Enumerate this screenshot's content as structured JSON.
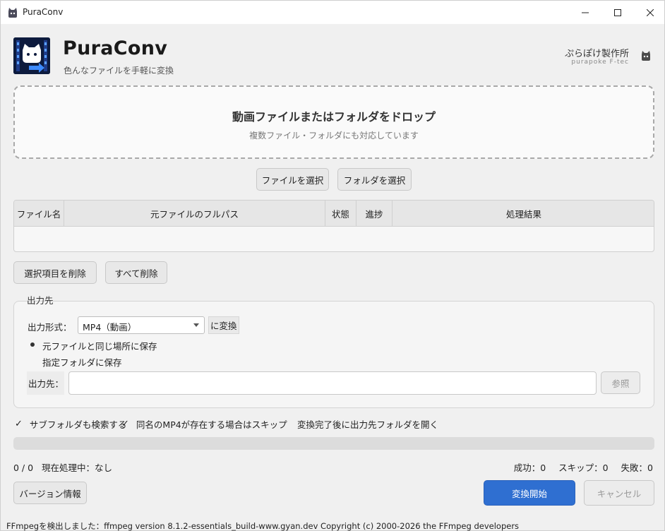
{
  "window": {
    "title": "PuraConv",
    "controls": {
      "minimize": "minimize-icon",
      "maximize": "maximize-icon",
      "close": "close-icon"
    }
  },
  "header": {
    "app_name": "PuraConv",
    "subtitle": "色んなファイルを手軽に変換",
    "maker": "ぷらぽけ製作所",
    "maker_sub": "purapoke F-tec"
  },
  "dropzone": {
    "title": "動画ファイルまたはフォルダをドロップ",
    "subtitle": "複数ファイル・フォルダにも対応しています"
  },
  "select_buttons": {
    "file": "ファイルを選択",
    "folder": "フォルダを選択"
  },
  "table": {
    "columns": [
      "ファイル名",
      "元ファイルのフルパス",
      "状態",
      "進捗",
      "処理結果"
    ],
    "rows": []
  },
  "list_actions": {
    "delete_selected": "選択項目を削除",
    "delete_all": "すべて削除"
  },
  "output": {
    "group_label": "出力先",
    "format_label": "出力形式：",
    "format_value": "MP4（動画）",
    "format_suffix": "に変換",
    "radio_same": "元ファイルと同じ場所に保存",
    "radio_folder": "指定フォルダに保存",
    "radio_selected": "same",
    "dest_label": "出力先：",
    "dest_value": "",
    "browse": "参照"
  },
  "options": {
    "subfolders": {
      "label": "サブフォルダも検索する",
      "checked": true
    },
    "skip_existing": {
      "label": "同名のMP4が存在する場合はスキップ",
      "checked": true
    },
    "open_after": {
      "label": "変換完了後に出力先フォルダを開く",
      "checked": false
    }
  },
  "progress": {
    "value": 0
  },
  "status": {
    "count": "0 / 0",
    "current": "現在処理中：なし",
    "success": "成功：0",
    "skip": "スキップ：0",
    "failed": "失敗：0"
  },
  "actions": {
    "version": "バージョン情報",
    "start": "変換開始",
    "cancel": "キャンセル"
  },
  "footer": {
    "text": "FFmpegを検出しました：ffmpeg version 8.1.2-essentials_build-www.gyan.dev Copyright (c) 2000-2026 the FFmpeg developers"
  },
  "colors": {
    "primary": "#2f6fd1",
    "background": "#f0f0f0",
    "logo_bg": "#0d1b3e"
  }
}
